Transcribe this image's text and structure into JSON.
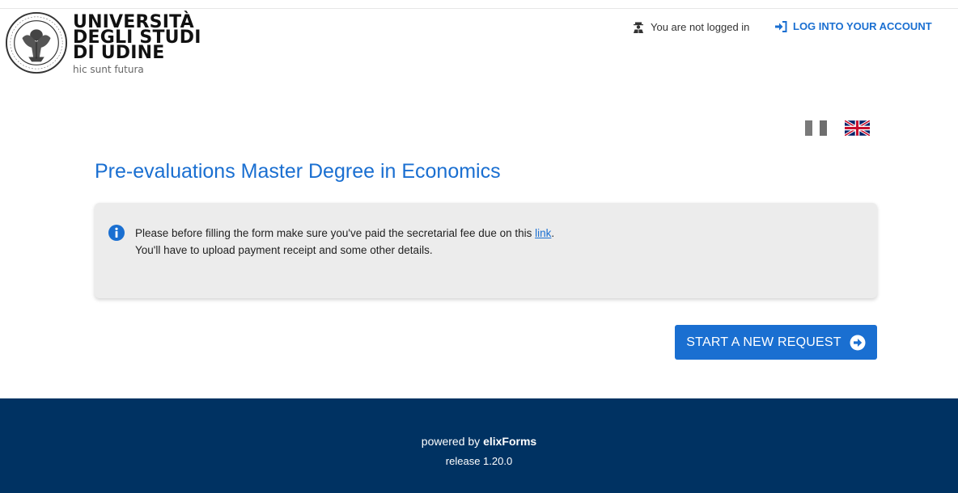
{
  "header": {
    "logo_lines": [
      "UNIVERSITÀ",
      "DEGLI STUDI",
      "DI UDINE"
    ],
    "logo_tagline": "hic sunt futura",
    "login_status": "You are not logged in",
    "login_link": "LOG INTO YOUR ACCOUNT"
  },
  "languages": [
    "it",
    "en"
  ],
  "main": {
    "title": "Pre-evaluations Master Degree in Economics",
    "info": {
      "line1_before_link": "Please before filling the form make sure you've paid the secretarial fee due on this ",
      "link_text": "link",
      "line1_after_link": ".",
      "line2": "You'll have to upload payment receipt and some other details."
    },
    "start_button": "START A NEW REQUEST"
  },
  "footer": {
    "powered_by": "powered by ",
    "brand": "elixForms",
    "release": "release 1.20.0"
  },
  "icons": {
    "seal": "university-seal-icon",
    "user": "user-icon",
    "login": "sign-in-icon",
    "info": "info-circle-icon",
    "arrow": "arrow-circle-right-icon"
  },
  "colors": {
    "accent": "#1a6fd1",
    "footer_bg": "#003262",
    "info_bg": "#ececec"
  }
}
